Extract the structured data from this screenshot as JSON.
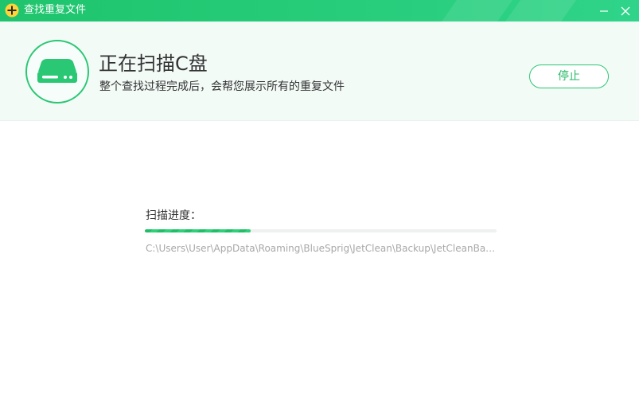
{
  "window": {
    "title": "查找重复文件",
    "minimize_icon": "minimize-icon",
    "close_icon": "close-icon",
    "app_icon": "app-logo-icon"
  },
  "header": {
    "drive_icon": "hard-drive-icon",
    "title": "正在扫描C盘",
    "subtitle": "整个查找过程完成后，会帮您展示所有的重复文件",
    "stop_label": "停止"
  },
  "scan": {
    "progress_label": "扫描进度：",
    "progress_fraction": 0.3,
    "current_path": "C:\\Users\\User\\AppData\\Roaming\\BlueSprig\\JetClean\\Backup\\JetCleanBac..."
  },
  "colors": {
    "accent": "#27c872",
    "accent_dark": "#22b865",
    "header_bg": "#f3fbf7",
    "progress_track": "#eef1ef",
    "path_text": "#a8a8a8",
    "title_text": "#333333"
  }
}
